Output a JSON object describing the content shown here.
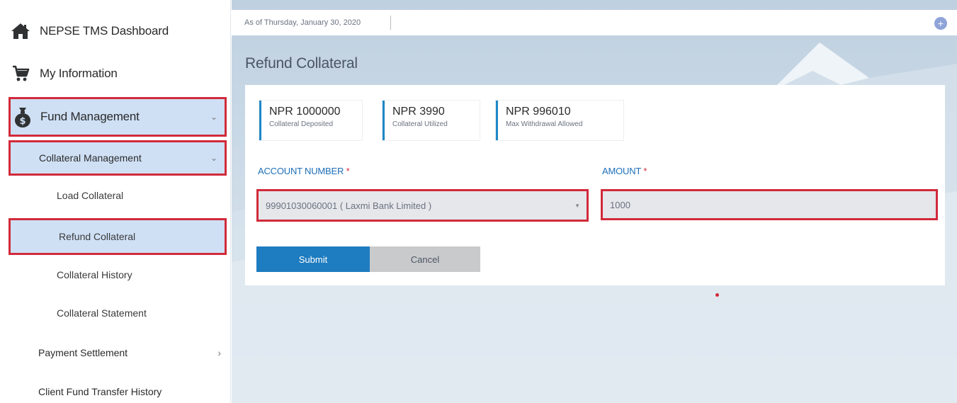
{
  "sidebar": {
    "dashboard_label": "NEPSE TMS Dashboard",
    "my_information_label": "My Information",
    "fund_management_label": "Fund Management",
    "collateral_management_label": "Collateral Management",
    "sub_items": [
      "Load Collateral",
      "Refund Collateral",
      "Collateral History",
      "Collateral Statement"
    ],
    "payment_settlement_label": "Payment Settlement",
    "client_fund_transfer_label": "Client Fund Transfer History",
    "icons": [
      "home-icon",
      "cart-icon",
      "money-bag-icon",
      "chevron-down-icon",
      "chevron-right-icon"
    ]
  },
  "topbar": {
    "date_text": "As of Thursday, January 30, 2020",
    "plus_icon": "+"
  },
  "page": {
    "title": "Refund Collateral"
  },
  "stats": [
    {
      "value": "NPR 1000000",
      "label": "Collateral Deposited"
    },
    {
      "value": "NPR 3990",
      "label": "Collateral Utilized"
    },
    {
      "value": "NPR 996010",
      "label": "Max Withdrawal Allowed"
    }
  ],
  "form": {
    "account_label": "ACCOUNT NUMBER",
    "amount_label": "AMOUNT",
    "required_mark": "*",
    "account_value": "99901030060001 ( Laxmi Bank Limited )",
    "amount_value": "1000",
    "submit_label": "Submit",
    "cancel_label": "Cancel"
  },
  "colors": {
    "accent": "#1e7cc0",
    "highlight_border": "#d12a3a",
    "active_bg": "#cfe0f5"
  }
}
